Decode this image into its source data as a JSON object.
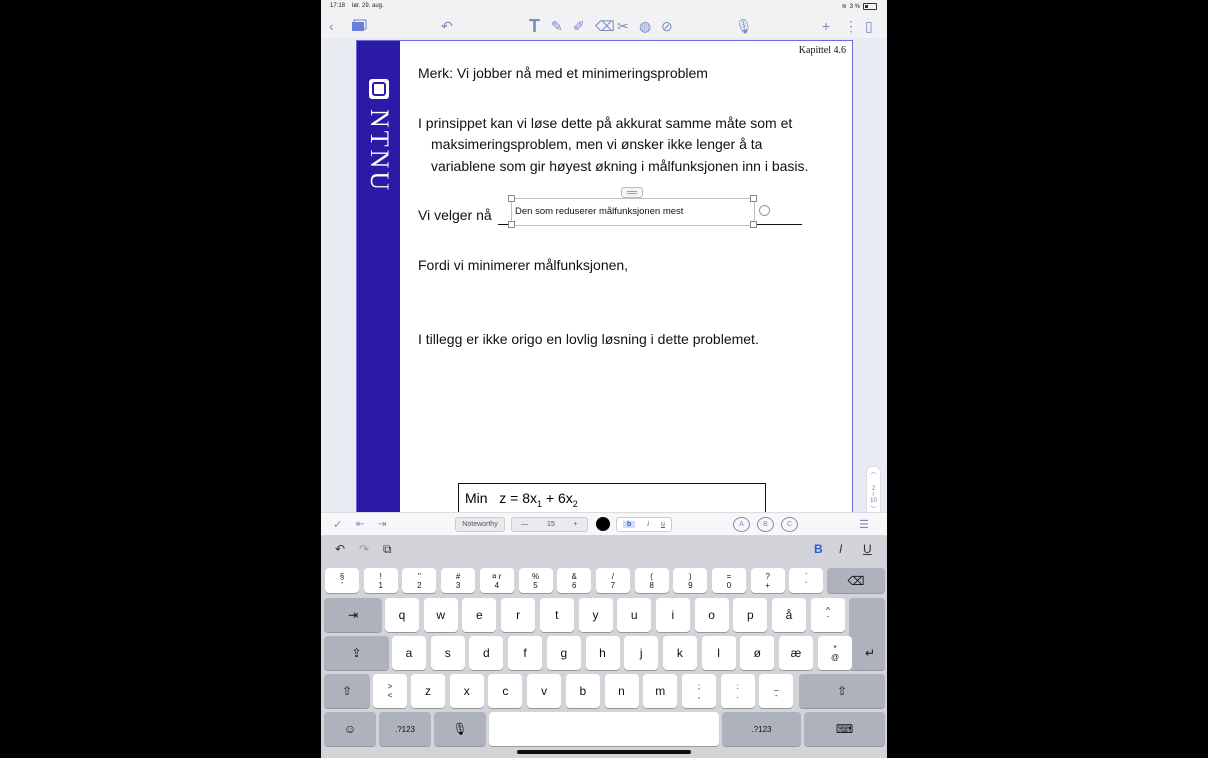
{
  "status": {
    "time": "17:18",
    "date": "lør. 29. aug.",
    "battery": "3 %"
  },
  "page": {
    "chapter": "Kapittel 4.6",
    "brand": "NTNU",
    "line1": "Merk: Vi jobber nå med et minimeringsproblem",
    "para_l1": "I prinsippet kan vi løse dette på akkurat samme måte som et",
    "para_l2": "maksimeringsproblem, men vi ønsker ikke lenger å ta",
    "para_l3": "variablene som gir høyest økning i målfunksjonen inn i basis.",
    "choose_label": "Vi velger nå",
    "textbox_value": "Den som reduserer målfunksjonen mest",
    "fordi": "Fordi vi minimerer målfunksjonen,",
    "tillegg": "I tillegg er ikke origo en lovlig løsning i dette problemet.",
    "formula": {
      "min": "Min",
      "lhs": "z = 8x",
      "sub1": "1",
      "mid": " + 6x",
      "sub2": "2"
    }
  },
  "pager": {
    "current": "2",
    "total": "10"
  },
  "format": {
    "font": "Noteworthy",
    "minus": "—",
    "size": "15",
    "plus": "+",
    "bold": "b",
    "italic": "i",
    "underline": "u",
    "circles": [
      "A",
      "B",
      "C"
    ]
  },
  "keyboard": {
    "top_right": {
      "bold": "B",
      "italic": "I",
      "underline": "U"
    },
    "row1": [
      [
        "§",
        "'"
      ],
      [
        "!",
        "1"
      ],
      [
        "\"",
        "2"
      ],
      [
        "#",
        "3"
      ],
      [
        "¤ r",
        "4"
      ],
      [
        "%",
        "5"
      ],
      [
        "&",
        "6"
      ],
      [
        "/",
        "7"
      ],
      [
        "(",
        "8"
      ],
      [
        ")",
        "9"
      ],
      [
        "=",
        "0"
      ],
      [
        "?",
        "+"
      ],
      [
        "`",
        "´"
      ]
    ],
    "row2": [
      "q",
      "w",
      "e",
      "r",
      "t",
      "y",
      "u",
      "i",
      "o",
      "p",
      "å"
    ],
    "row2_extra": [
      "^",
      "¨"
    ],
    "row3": [
      "a",
      "s",
      "d",
      "f",
      "g",
      "h",
      "j",
      "k",
      "l",
      "ø",
      "æ"
    ],
    "row3_extra": [
      "*",
      "@"
    ],
    "row4_first": [
      ">",
      "<"
    ],
    "row4": [
      "z",
      "x",
      "c",
      "v",
      "b",
      "n",
      "m"
    ],
    "row4_extra": [
      [
        ";",
        ","
      ],
      [
        ":",
        "."
      ],
      [
        "_",
        "-"
      ]
    ],
    "num_label": ".?123"
  }
}
